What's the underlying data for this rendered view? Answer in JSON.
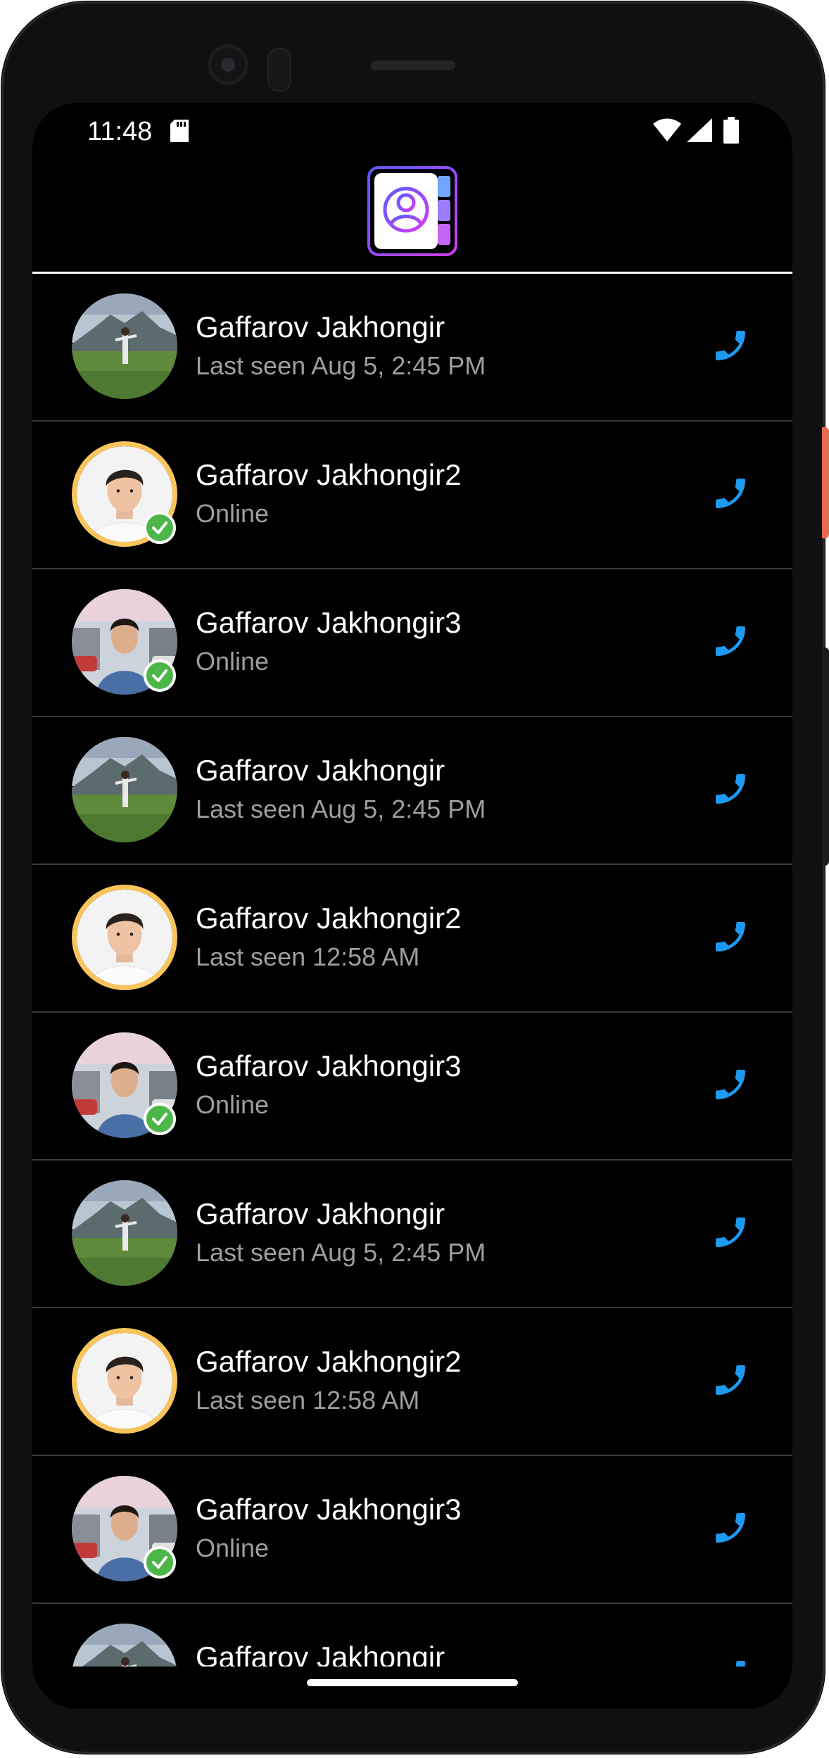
{
  "status_bar": {
    "time": "11:48",
    "icons": [
      "sd-card-icon",
      "wifi-icon",
      "signal-icon",
      "battery-icon"
    ]
  },
  "header": {
    "logo": "contacts-book-icon",
    "colors": {
      "gradient_start": "#5b5bff",
      "gradient_end": "#d23cf5",
      "accent": "#4da3ff"
    }
  },
  "colors": {
    "background": "#000000",
    "name_text": "#ffffff",
    "status_text": "#9e9e9e",
    "call_icon": "#1e9af1",
    "online_badge": "#4cb648",
    "avatar_ring": "#f9c55b",
    "divider": "#3a3a3a"
  },
  "contacts": [
    {
      "name": "Gaffarov Jakhongir",
      "status": "Last seen Aug 5, 2:45 PM",
      "avatar": "landscape-photo",
      "online": false,
      "ring": false
    },
    {
      "name": "Gaffarov Jakhongir2",
      "status": "Online",
      "avatar": "portrait-photo",
      "online": true,
      "ring": true
    },
    {
      "name": "Gaffarov Jakhongir3",
      "status": "Online",
      "avatar": "street-photo",
      "online": true,
      "ring": false
    },
    {
      "name": "Gaffarov Jakhongir",
      "status": "Last seen Aug 5, 2:45 PM",
      "avatar": "landscape-photo",
      "online": false,
      "ring": false
    },
    {
      "name": "Gaffarov Jakhongir2",
      "status": "Last seen 12:58 AM",
      "avatar": "portrait-photo",
      "online": false,
      "ring": true
    },
    {
      "name": "Gaffarov Jakhongir3",
      "status": "Online",
      "avatar": "street-photo",
      "online": true,
      "ring": false
    },
    {
      "name": "Gaffarov Jakhongir",
      "status": "Last seen Aug 5, 2:45 PM",
      "avatar": "landscape-photo",
      "online": false,
      "ring": false
    },
    {
      "name": "Gaffarov Jakhongir2",
      "status": "Last seen 12:58 AM",
      "avatar": "portrait-photo",
      "online": false,
      "ring": true
    },
    {
      "name": "Gaffarov Jakhongir3",
      "status": "Online",
      "avatar": "street-photo",
      "online": true,
      "ring": false
    },
    {
      "name": "Gaffarov Jakhongir",
      "status": "",
      "avatar": "landscape-photo",
      "online": false,
      "ring": false
    }
  ]
}
